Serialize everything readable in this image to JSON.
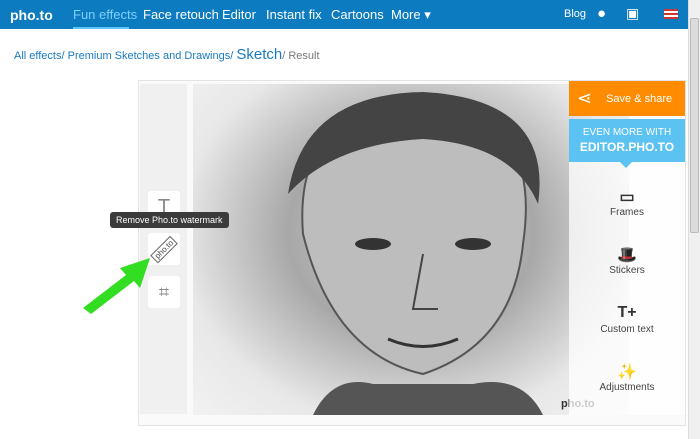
{
  "nav": {
    "logo": "pho.to",
    "items": [
      "Fun effects",
      "Face retouch",
      "Editor",
      "Instant fix",
      "Cartoons",
      "More ▾"
    ],
    "blog": "Blog"
  },
  "breadcrumb": {
    "all": "All effects/",
    "premium": "Premium Sketches and Drawings/",
    "sketch": "Sketch",
    "result": "/ Result"
  },
  "tooltip": "Remove Pho.to watermark",
  "watermark_tool": "pho.to",
  "photo_watermark": "pho.to",
  "right": {
    "save": "Save & share",
    "more1": "EVEN MORE WITH",
    "more2": "EDITOR.PHO.TO",
    "items": [
      "Frames",
      "Stickers",
      "Custom text",
      "Adjustments"
    ]
  },
  "colors": {
    "nav": "#0c7bc0",
    "save": "#ff8c00",
    "more": "#5bc2f2",
    "arrow": "#33dd22"
  }
}
